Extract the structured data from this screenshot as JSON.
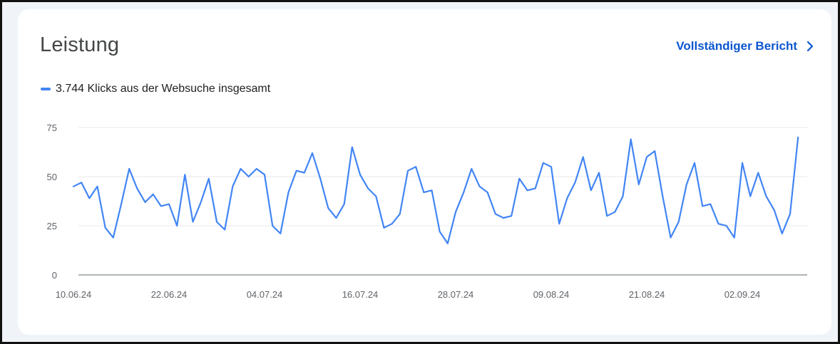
{
  "card": {
    "title": "Leistung",
    "report_link": "Vollständiger Bericht",
    "chevron_icon": "chevron-right-icon"
  },
  "colors": {
    "series": "#4285f4",
    "link": "#0b57d0",
    "grid": "#e8eaed",
    "axis": "#80868b"
  },
  "chart_data": {
    "type": "line",
    "legend": "3.744 Klicks aus der Websuche insgesamt",
    "legend_position": "top-left",
    "grid": true,
    "ylim": [
      0,
      75
    ],
    "yticks": [
      0,
      25,
      50,
      75
    ],
    "x_tick_labels": [
      "10.06.24",
      "22.06.24",
      "04.07.24",
      "16.07.24",
      "28.07.24",
      "09.08.24",
      "21.08.24",
      "02.09.24"
    ],
    "x_start": "10.06.24",
    "x_end": "11.09.24",
    "series": [
      {
        "name": "3.744 Klicks aus der Websuche insgesamt",
        "values": [
          45,
          47,
          39,
          45,
          24,
          19,
          36,
          54,
          44,
          37,
          41,
          35,
          36,
          25,
          51,
          27,
          37,
          49,
          27,
          23,
          45,
          54,
          50,
          54,
          51,
          25,
          21,
          42,
          53,
          52,
          62,
          49,
          34,
          29,
          36,
          65,
          51,
          44,
          40,
          24,
          26,
          31,
          53,
          55,
          42,
          43,
          22,
          16,
          32,
          42,
          54,
          45,
          42,
          31,
          29,
          30,
          49,
          43,
          44,
          57,
          55,
          26,
          39,
          47,
          60,
          43,
          52,
          30,
          32,
          40,
          69,
          46,
          60,
          63,
          40,
          19,
          27,
          46,
          57,
          35,
          36,
          26,
          25,
          19,
          57,
          40,
          52,
          40,
          33,
          21,
          31,
          70
        ]
      }
    ]
  }
}
